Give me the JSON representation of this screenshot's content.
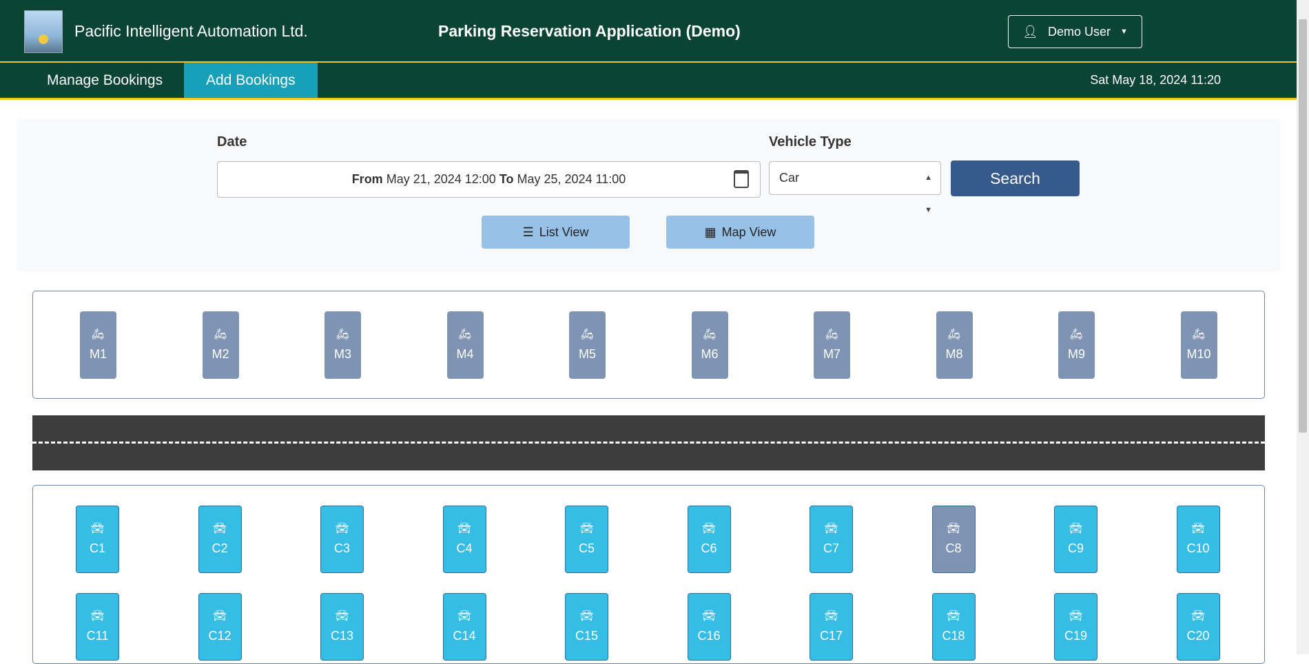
{
  "header": {
    "company": "Pacific Intelligent Automation Ltd.",
    "app_title": "Parking Reservation Application (Demo)",
    "user_label": "Demo User",
    "user_icon": "user-icon",
    "colors": {
      "header_bg": "#0b4433",
      "accent_line": "#f0c419"
    }
  },
  "nav": {
    "tabs": [
      {
        "label": "Manage Bookings",
        "active": false
      },
      {
        "label": "Add Bookings",
        "active": true
      }
    ],
    "datetime": "Sat May 18, 2024 11:20"
  },
  "search": {
    "date_label": "Date",
    "from_word": "From",
    "from_value": "May 21, 2024 12:00",
    "to_word": "To",
    "to_value": "May 25, 2024 11:00",
    "vehicle_label": "Vehicle Type",
    "vehicle_value": "Car",
    "search_label": "Search",
    "list_view_label": "List View",
    "map_view_label": "Map View"
  },
  "map": {
    "motorcycle_spots": [
      {
        "id": "M1"
      },
      {
        "id": "M2"
      },
      {
        "id": "M3"
      },
      {
        "id": "M4"
      },
      {
        "id": "M5"
      },
      {
        "id": "M6"
      },
      {
        "id": "M7"
      },
      {
        "id": "M8"
      },
      {
        "id": "M9"
      },
      {
        "id": "M10"
      }
    ],
    "car_spots": [
      {
        "id": "C1",
        "available": true
      },
      {
        "id": "C2",
        "available": true
      },
      {
        "id": "C3",
        "available": true
      },
      {
        "id": "C4",
        "available": true
      },
      {
        "id": "C5",
        "available": true
      },
      {
        "id": "C6",
        "available": true
      },
      {
        "id": "C7",
        "available": true
      },
      {
        "id": "C8",
        "available": false
      },
      {
        "id": "C9",
        "available": true
      },
      {
        "id": "C10",
        "available": true
      },
      {
        "id": "C11",
        "available": true
      },
      {
        "id": "C12",
        "available": true
      },
      {
        "id": "C13",
        "available": true
      },
      {
        "id": "C14",
        "available": true
      },
      {
        "id": "C15",
        "available": true
      },
      {
        "id": "C16",
        "available": true
      },
      {
        "id": "C17",
        "available": true
      },
      {
        "id": "C18",
        "available": true
      },
      {
        "id": "C19",
        "available": true
      },
      {
        "id": "C20",
        "available": true
      }
    ],
    "colors": {
      "available": "#35bde6",
      "unavailable": "#7f94b3"
    }
  }
}
